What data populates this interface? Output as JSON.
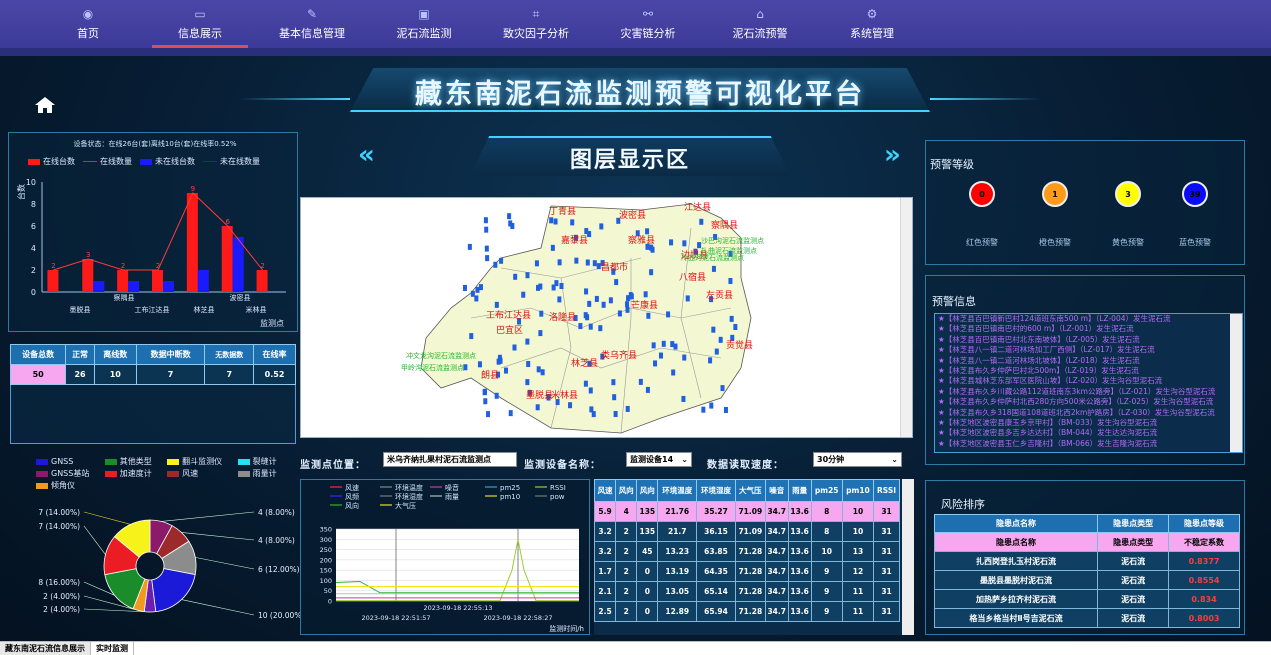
{
  "nav": {
    "items": [
      {
        "label": "首页",
        "icon": "home-circle-icon"
      },
      {
        "label": "信息展示",
        "icon": "screen-icon",
        "active": true
      },
      {
        "label": "基本信息管理",
        "icon": "pen-icon"
      },
      {
        "label": "泥石流监测",
        "icon": "monitor-icon"
      },
      {
        "label": "致灾因子分析",
        "icon": "graph-icon"
      },
      {
        "label": "灾害链分析",
        "icon": "chain-icon"
      },
      {
        "label": "泥石流预警",
        "icon": "bank-icon"
      },
      {
        "label": "系统管理",
        "icon": "gear-icon"
      }
    ]
  },
  "header": {
    "title": "藏东南泥石流监测预警可视化平台",
    "layer_title": "图层显示区"
  },
  "left": {
    "status": "设备状态：在线26台(套)离线10台(套)在线率0.52%",
    "bar_legend": [
      "在线台数",
      "在线数量",
      "未在线台数",
      "未在线数量"
    ],
    "ylabel": "台数",
    "xlabel": "监测点",
    "table": {
      "headers": [
        "设备总数",
        "正常",
        "离线数",
        "数据中断数",
        "无数据数",
        "在线率"
      ],
      "row": [
        "50",
        "26",
        "10",
        "7",
        "7",
        "0.52"
      ]
    },
    "device_legend": [
      "GNSS",
      "其他类型",
      "翻斗监测仪",
      "裂缝计",
      "GNSS基站",
      "加速度计",
      "风速",
      "雨量计",
      "倾角仪"
    ]
  },
  "chart_data": [
    {
      "type": "bar",
      "categories": [
        "",
        "察隅县",
        "",
        "工布江达县",
        "",
        "林芝县",
        "",
        "波密县",
        "",
        "米林县",
        ""
      ],
      "x_ticks": [
        "墨脱县",
        "工布江达县",
        "林芝县",
        "米林县"
      ],
      "series": [
        {
          "name": "在线台数",
          "values": [
            2,
            3,
            2,
            2,
            9,
            6,
            2
          ]
        },
        {
          "name": "未在线台数",
          "values": [
            0,
            1,
            1,
            1,
            2,
            5,
            0
          ]
        }
      ],
      "labels": [
        2,
        3,
        2,
        2,
        9,
        6,
        2
      ],
      "ylim": [
        0,
        10
      ],
      "yticks": [
        0,
        2,
        4,
        6,
        8,
        10
      ]
    },
    {
      "type": "pie",
      "slices": [
        {
          "label": "4 (8.00%)",
          "value": 4,
          "color": "#8b1a6b"
        },
        {
          "label": "4 (8.00%)",
          "value": 4,
          "color": "#9c2a2a"
        },
        {
          "label": "6 (12.00%)",
          "value": 6,
          "color": "#8c8c8c"
        },
        {
          "label": "10 (20.00%)",
          "value": 10,
          "color": "#1a1ad8"
        },
        {
          "label": "2 (4.00%)",
          "value": 2,
          "color": "#6a1fb0"
        },
        {
          "label": "2 (4.00%)",
          "value": 2,
          "color": "#f29a1f"
        },
        {
          "label": "8 (16.00%)",
          "value": 8,
          "color": "#1b8c2a"
        },
        {
          "label": "7 (14.00%)",
          "value": 7,
          "color": "#ec1c24"
        },
        {
          "label": "7 (14.00%)",
          "value": 7,
          "color": "#f7f21a"
        }
      ]
    },
    {
      "type": "line",
      "legend": [
        "风速",
        "环境温度",
        "噪音",
        "pm25",
        "RSSI",
        "风频",
        "环境湿度",
        "雨量",
        "pm10",
        "pow",
        "风向",
        "大气压"
      ],
      "yticks": [
        0,
        50,
        100,
        150,
        200,
        250,
        300,
        350
      ],
      "ylim": [
        0,
        350
      ],
      "x_ticks": [
        "2023-09-18 22:51:57",
        "2023-09-18 22:55:13",
        "2023-09-18 22:58:27"
      ],
      "xlabel": "监测时间/h"
    }
  ],
  "map": {
    "counties": [
      "丁青县",
      "江达县",
      "芒康县",
      "八宿县",
      "左贡县",
      "察雅县",
      "昌都市",
      "贡觉县",
      "边坝县",
      "洛隆县",
      "类乌齐县",
      "嘉黎县",
      "工布江达县",
      "林芝县",
      "波密县",
      "察隅县",
      "米林县",
      "朗县",
      "墨脱县",
      "巴宜区"
    ],
    "points": [
      "沙巴沟泥石流监测点",
      "扎曲泥石流监测点",
      "冷曲河泥石流监测点",
      "冲文龙沟泥石流监测点",
      "甲岭沟泥石流监测点"
    ]
  },
  "controls": {
    "point_label": "监测点位置：",
    "point_value": "米乌齐纳扎果村泥石流监测点",
    "device_label": "监测设备名称：",
    "device_value": "监测设备14",
    "speed_label": "数据读取速度：",
    "speed_value": "30分钟"
  },
  "datatable": {
    "headers": [
      "风速",
      "风向",
      "风向",
      "环境温度",
      "环境湿度",
      "大气压",
      "噪音",
      "雨量",
      "pm25",
      "pm10",
      "RSSI"
    ],
    "rows": [
      [
        "5.9",
        "4",
        "135",
        "21.76",
        "35.27",
        "71.09",
        "34.7",
        "13.6",
        "8",
        "10",
        "31"
      ],
      [
        "3.2",
        "2",
        "135",
        "21.7",
        "36.15",
        "71.09",
        "34.7",
        "13.6",
        "8",
        "10",
        "31"
      ],
      [
        "3.2",
        "2",
        "45",
        "13.23",
        "63.85",
        "71.28",
        "34.7",
        "13.6",
        "10",
        "13",
        "31"
      ],
      [
        "1.7",
        "2",
        "0",
        "13.19",
        "64.35",
        "71.28",
        "34.7",
        "13.6",
        "9",
        "12",
        "31"
      ],
      [
        "2.1",
        "2",
        "0",
        "13.05",
        "65.14",
        "71.28",
        "34.7",
        "13.6",
        "9",
        "11",
        "31"
      ],
      [
        "2.5",
        "2",
        "0",
        "12.89",
        "65.94",
        "71.28",
        "34.7",
        "13.6",
        "9",
        "11",
        "31"
      ]
    ]
  },
  "right": {
    "warn_title": "预警等级",
    "levels": [
      {
        "num": "0",
        "color": "#ff0000",
        "label": "红色预警"
      },
      {
        "num": "1",
        "color": "#ff9a1a",
        "label": "橙色预警"
      },
      {
        "num": "3",
        "color": "#ffff00",
        "label": "黄色预警"
      },
      {
        "num": "39",
        "color": "#0a0aff",
        "label": "蓝色预警"
      }
    ],
    "info_title": "预警信息",
    "alerts": [
      "★【林芝县百巴镇新巴村124道班东南500 m】（LZ-004）发生泥石流",
      "★【林芝县百巴镇南巴村的600 m】（LZ-001）发生泥石流",
      "★【林芝县百巴镇南巴村北东南坡体】（LZ-005）发生泥石流",
      "★【林芝县八一镇二道河林场加工厂西侧】（LZ-017）发生泥石流",
      "★【林芝县八一镇二道河林场北坡体】（LZ-018）发生泥石流",
      "★【林芝县布久乡仲萨巴村北500m】（LZ-019）发生泥石流",
      "★【林芝县城林芝东部军区医院山坡】（LZ-020）发生沟谷型泥石流",
      "★【林芝县布久乡川藏公路112道班南东3km公路旁】（LZ-021）发生沟谷型泥石流",
      "★【林芝县布久乡仲萨村北西280方向500米公路旁】（LZ-025）发生沟谷型泥石流",
      "★【林芝县布久乡318国道108道班北西2km护路房】（LZ-030）发生沟谷型泥石流",
      "★【林芝地区波密县康玉乡京甲村】（BM-033）发生沟谷型泥石流",
      "★【林芝地区波密县多吉乡达达村】（BM-044）发生达达沟泥石流",
      "★【林芝地区波密县玉仁乡吉隆村】（BM-066）发生吉隆沟泥石流"
    ],
    "risk_title": "风险排序",
    "risk_headers": [
      "隐患点名称",
      "隐患点类型",
      "隐患点等级"
    ],
    "risk_sub": [
      "隐患点名称",
      "隐患点类型",
      "不稳定系数"
    ],
    "risk_rows": [
      [
        "扎西岗登扎玉村泥石流",
        "泥石流",
        "0.8377"
      ],
      [
        "墨脱县墨脱村泥石流",
        "泥石流",
        "0.8554"
      ],
      [
        "加热萨乡拉齐村泥石流",
        "泥石流",
        "0.834"
      ],
      [
        "格当乡格当村Ⅱ号吉泥石流",
        "泥石流",
        "0.8003"
      ]
    ]
  },
  "bottom": {
    "tabs": [
      "藏东南泥石流信息展示",
      "实时监测"
    ]
  }
}
